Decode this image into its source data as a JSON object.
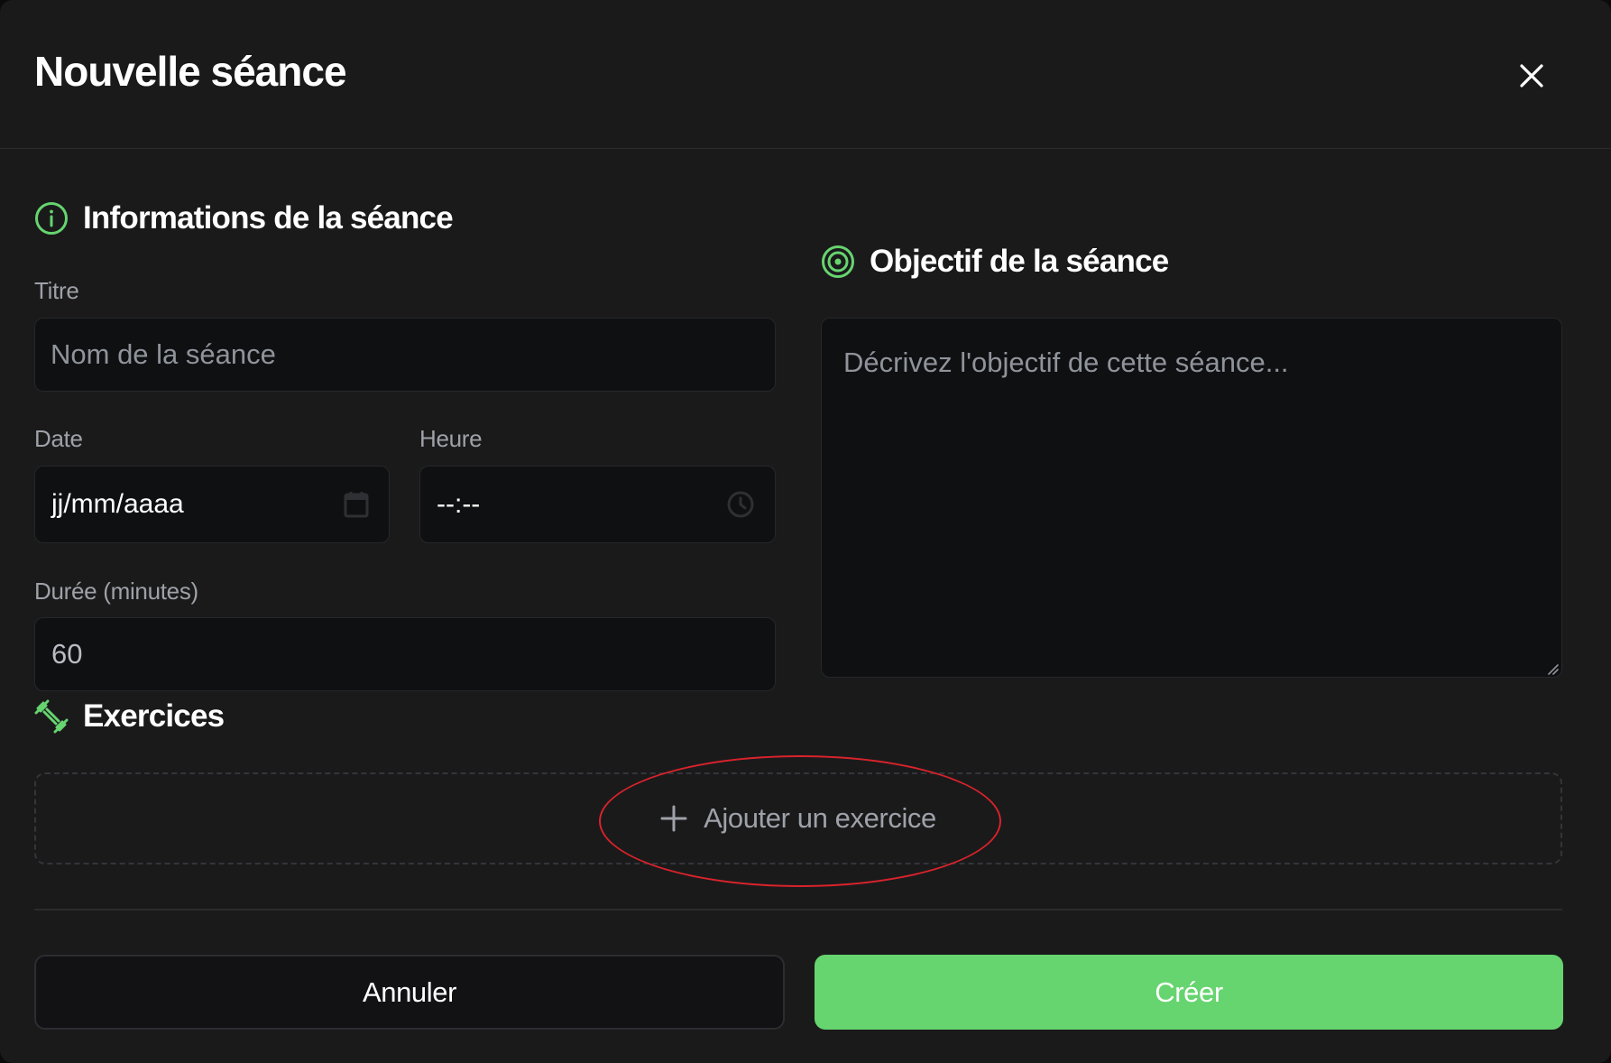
{
  "modal": {
    "title": "Nouvelle séance"
  },
  "info_section": {
    "heading": "Informations de la séance",
    "title_field": {
      "label": "Titre",
      "placeholder": "Nom de la séance",
      "value": ""
    },
    "date_field": {
      "label": "Date",
      "value": "jj/mm/aaaa"
    },
    "time_field": {
      "label": "Heure",
      "value": "--:--"
    },
    "duration_field": {
      "label": "Durée (minutes)",
      "value": "60"
    }
  },
  "objective_section": {
    "heading": "Objectif de la séance",
    "placeholder": "Décrivez l'objectif de cette séance..."
  },
  "exercises_section": {
    "heading": "Exercices",
    "add_label": "Ajouter un exercice"
  },
  "footer": {
    "cancel_label": "Annuler",
    "create_label": "Créer"
  },
  "colors": {
    "accent": "#66d46f",
    "background": "#1a1a1b",
    "input_background": "#0f1012",
    "muted_text": "#9ea1a8",
    "annotation": "#d9232b"
  },
  "icons": {
    "close": "close-icon",
    "info": "info-circle-icon",
    "target": "target-icon",
    "dumbbell": "dumbbell-icon",
    "calendar": "calendar-icon",
    "clock": "clock-icon",
    "plus": "plus-icon"
  }
}
